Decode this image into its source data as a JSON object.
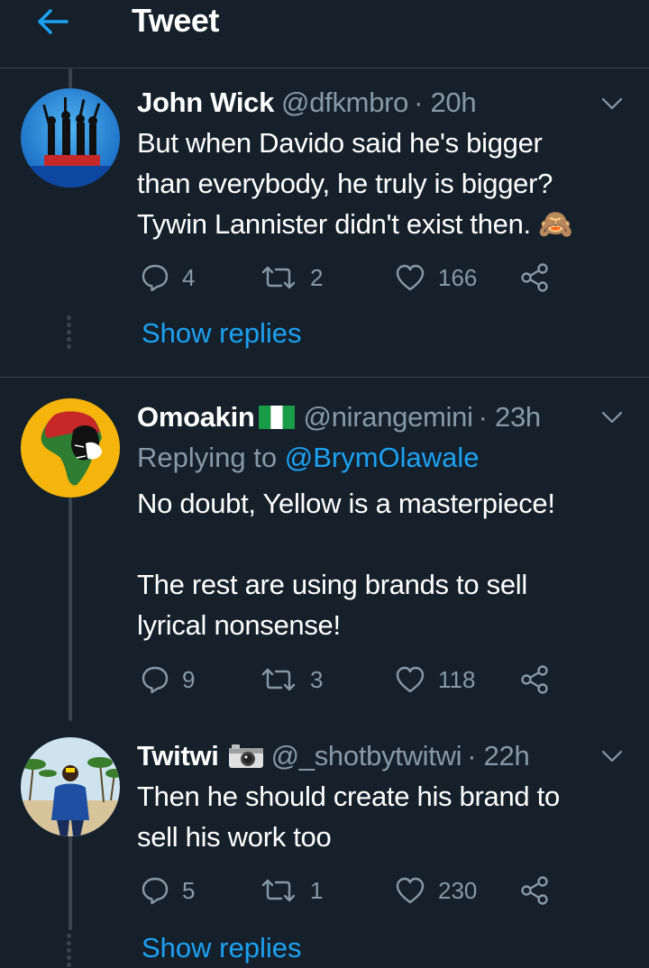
{
  "header": {
    "title": "Tweet",
    "back_icon": "arrow-left-icon"
  },
  "colors": {
    "background": "#15202b",
    "accent": "#1da1f2",
    "muted": "#8899a6",
    "divider": "#38444d"
  },
  "tweets": [
    {
      "name": "John Wick",
      "handle": "@dfkmbro",
      "time": "· 20h",
      "reply_to_prefix": "",
      "reply_to_user": "",
      "text": "But when Davido said he's bigger\nthan everybody, he truly is bigger?\nTywin Lannister didn't exist then.",
      "emoji": "🙈",
      "replies": "4",
      "retweets": "2",
      "likes": "166",
      "show_replies": "Show replies"
    },
    {
      "name": "Omoakin",
      "handle": "@nirangemini",
      "time": "· 23h",
      "reply_to_prefix": "Replying to",
      "reply_to_user": "@BrymOlawale",
      "text": "No doubt,  Yellow is a masterpiece!\n\nThe rest are using brands to sell\nlyrical nonsense!",
      "replies": "9",
      "retweets": "3",
      "likes": "118"
    },
    {
      "name": "Twitwi",
      "handle": "@_shotbytwitwi",
      "time": "· 22h",
      "text": "Then he should create his brand to\nsell his work too",
      "replies": "5",
      "retweets": "1",
      "likes": "230",
      "show_replies": "Show replies"
    }
  ]
}
